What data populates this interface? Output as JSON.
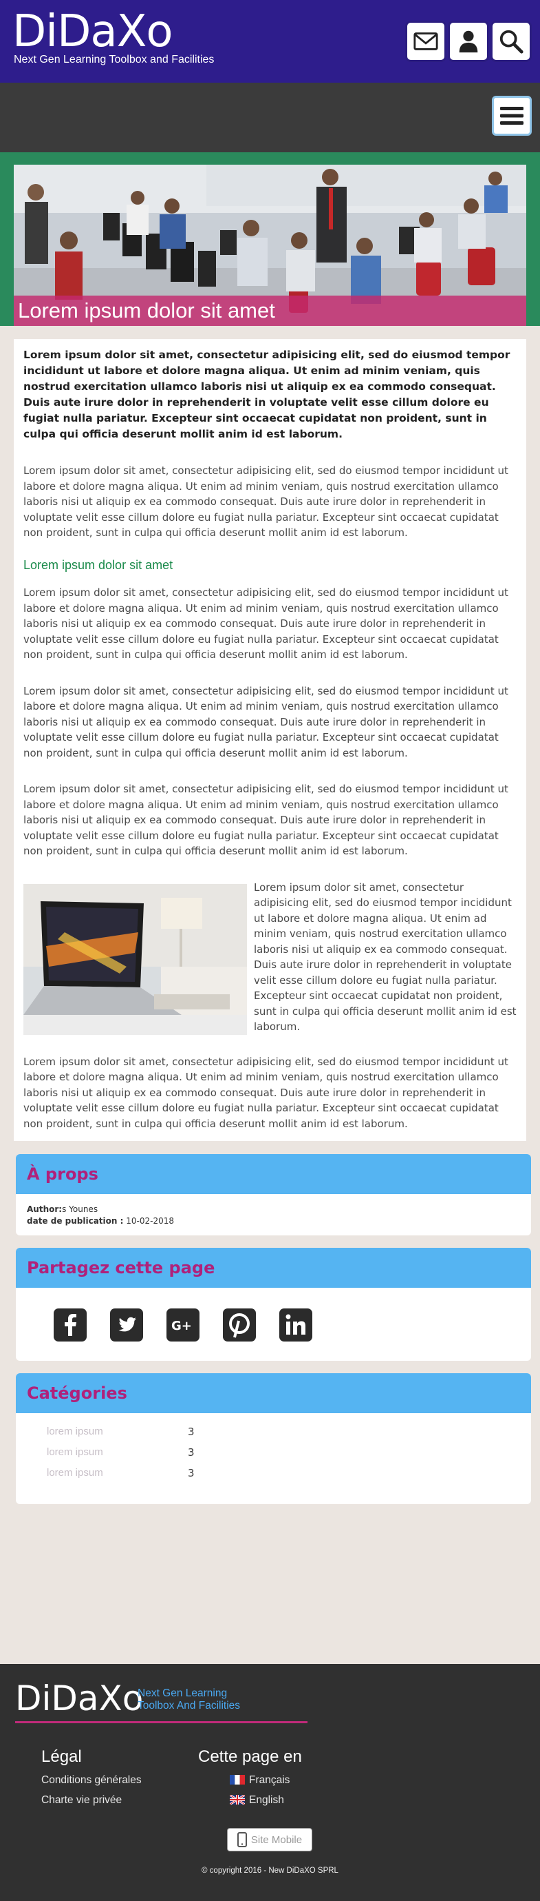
{
  "header": {
    "logo": "DiDaXo",
    "tagline": "Next Gen Learning Toolbox and Facilities",
    "icons": [
      "envelope-icon",
      "user-icon",
      "search-icon"
    ],
    "color": "#2e1d8c"
  },
  "nav": {
    "menu_icon": "hamburger-icon"
  },
  "hero": {
    "title": "Lorem ipsum dolor sit amet",
    "band_color": "#2a8a5c",
    "title_color": "#c42a6e"
  },
  "article": {
    "lead": "Lorem ipsum dolor sit amet, consectetur adipisicing elit, sed do eiusmod tempor incididunt ut labore et dolore magna aliqua. Ut enim ad minim veniam, quis nostrud exercitation ullamco laboris nisi ut aliquip ex ea commodo consequat. Duis aute irure dolor in reprehenderit in voluptate velit esse cillum dolore eu fugiat nulla pariatur. Excepteur sint occaecat cupidatat non proident, sunt in culpa qui officia deserunt mollit anim id est laborum.",
    "p1": "Lorem ipsum dolor sit amet, consectetur adipisicing elit, sed do eiusmod tempor incididunt ut labore et dolore magna aliqua. Ut enim ad minim veniam, quis nostrud exercitation ullamco laboris nisi ut aliquip ex ea commodo consequat. Duis aute irure dolor in reprehenderit in voluptate velit esse cillum dolore eu fugiat nulla pariatur. Excepteur sint occaecat cupidatat non proident, sunt in culpa qui officia deserunt mollit anim id est laborum.",
    "subheading": "Lorem ipsum dolor sit amet",
    "p2": "Lorem ipsum dolor sit amet, consectetur adipisicing elit, sed do eiusmod tempor incididunt ut labore et dolore magna aliqua. Ut enim ad minim veniam, quis nostrud exercitation ullamco laboris nisi ut aliquip ex ea commodo consequat. Duis aute irure dolor in reprehenderit in voluptate velit esse cillum dolore eu fugiat nulla pariatur. Excepteur sint occaecat cupidatat non proident, sunt in culpa qui officia deserunt mollit anim id est laborum.",
    "p3": "Lorem ipsum dolor sit amet, consectetur adipisicing elit, sed do eiusmod tempor incididunt ut labore et dolore magna aliqua. Ut enim ad minim veniam, quis nostrud exercitation ullamco laboris nisi ut aliquip ex ea commodo consequat. Duis aute irure dolor in reprehenderit in voluptate velit esse cillum dolore eu fugiat nulla pariatur. Excepteur sint occaecat cupidatat non proident, sunt in culpa qui officia deserunt mollit anim id est laborum.",
    "p4": "Lorem ipsum dolor sit amet, consectetur adipisicing elit, sed do eiusmod tempor incididunt ut labore et dolore magna aliqua. Ut enim ad minim veniam, quis nostrud exercitation ullamco laboris nisi ut aliquip ex ea commodo consequat. Duis aute irure dolor in reprehenderit in voluptate velit esse cillum dolore eu fugiat nulla pariatur. Excepteur sint occaecat cupidatat non proident, sunt in culpa qui officia deserunt mollit anim id est laborum.",
    "media_text": "Lorem ipsum dolor sit amet, consectetur adipisicing elit, sed do eiusmod tempor incididunt ut labore et dolore magna aliqua. Ut enim ad minim veniam, quis nostrud exercitation ullamco laboris nisi ut aliquip ex ea commodo consequat. Duis aute irure dolor in reprehenderit in voluptate velit esse cillum dolore eu fugiat nulla pariatur. Excepteur sint occaecat cupidatat non proident, sunt in culpa qui officia deserunt mollit anim id est laborum.",
    "p5": "Lorem ipsum dolor sit amet, consectetur adipisicing elit, sed do eiusmod tempor incididunt ut labore et dolore magna aliqua. Ut enim ad minim veniam, quis nostrud exercitation ullamco laboris nisi ut aliquip ex ea commodo consequat. Duis aute irure dolor in reprehenderit in voluptate velit esse cillum dolore eu fugiat nulla pariatur. Excepteur sint occaecat cupidatat non proident, sunt in culpa qui officia deserunt mollit anim id est laborum."
  },
  "about": {
    "title": "À props",
    "author_label": "Author:",
    "author_value": "s Younes",
    "date_label": "date de publication :",
    "date_value": "10-02-2018"
  },
  "share": {
    "title": "Partagez cette page",
    "icons": [
      "facebook-icon",
      "twitter-icon",
      "google-plus-icon",
      "pinterest-icon",
      "linkedin-icon"
    ]
  },
  "categories": {
    "title": "Catégories",
    "items": [
      {
        "name": "lorem ipsum",
        "count": "3"
      },
      {
        "name": "lorem ipsum",
        "count": "3"
      },
      {
        "name": "lorem ipsum",
        "count": "3"
      }
    ]
  },
  "footer": {
    "logo": "DiDaXo",
    "tagline": "Next Gen Learning Toolbox And Facilities",
    "legal_title": "Légal",
    "legal_links": [
      "Conditions générales",
      "Charte vie privée"
    ],
    "lang_title": "Cette page en",
    "languages": [
      "Français",
      "English"
    ],
    "mobile_button": "Site Mobile",
    "copyright": "© copyright 2016 - New DiDaXO SPRL"
  },
  "colors": {
    "accent_blue": "#55b4f2",
    "accent_pink": "#b0217a",
    "accent_green": "#1a8a4a"
  }
}
